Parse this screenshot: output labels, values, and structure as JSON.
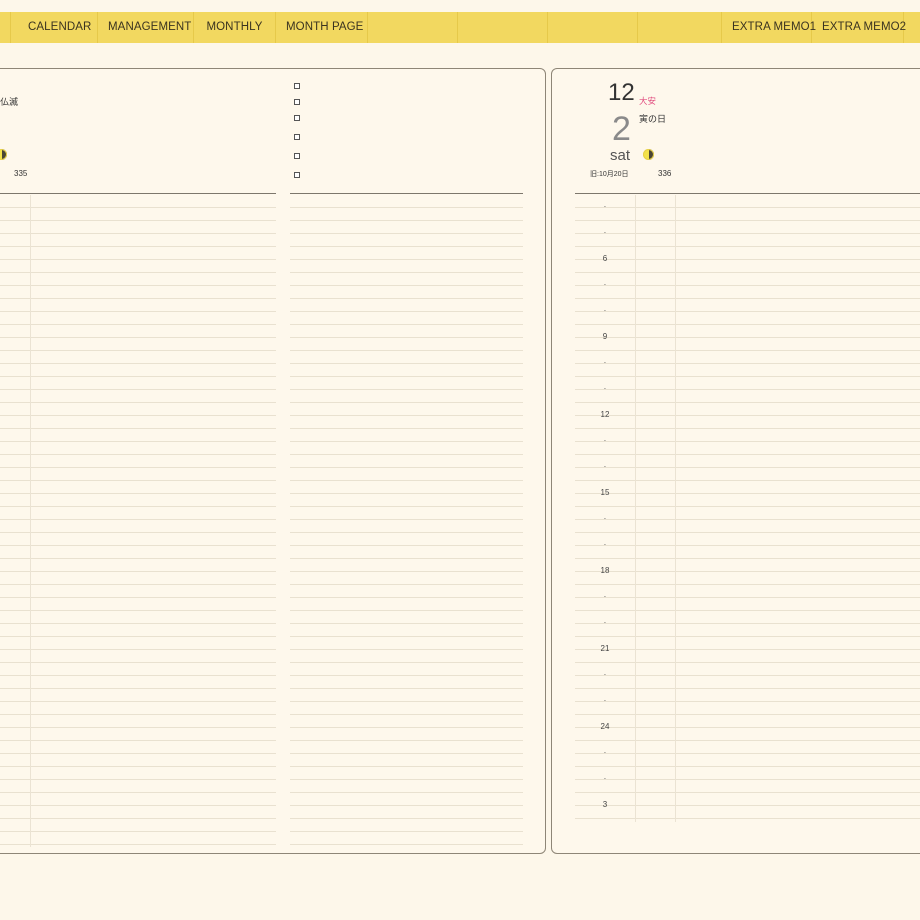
{
  "topbar": {
    "tabs": [
      "CALENDAR",
      "MANAGEMENT",
      "MONTHLY",
      "MONTH PAGE"
    ],
    "extra_tabs": [
      "EXTRA MEMO1",
      "EXTRA MEMO2"
    ]
  },
  "left_page": {
    "header_text_partial": "仏滅",
    "day_of_year": "335"
  },
  "right_page": {
    "month": "12",
    "rokuyo": "大安",
    "eto_day": "寅の日",
    "day": "2",
    "weekday": "sat",
    "lunar_date": "旧:10月20日",
    "day_of_year": "336",
    "hour_labels": [
      "·",
      "·",
      "6",
      "·",
      "·",
      "9",
      "·",
      "·",
      "12",
      "·",
      "·",
      "15",
      "·",
      "·",
      "18",
      "·",
      "·",
      "21",
      "·",
      "·",
      "24",
      "·",
      "·",
      "3"
    ]
  },
  "colors": {
    "accent_yellow": "#f2d860",
    "background": "#fdf7ea",
    "rokuyo_pink": "#e0497c"
  },
  "icons": [
    "moon-phase-icon",
    "checkbox-icon"
  ]
}
